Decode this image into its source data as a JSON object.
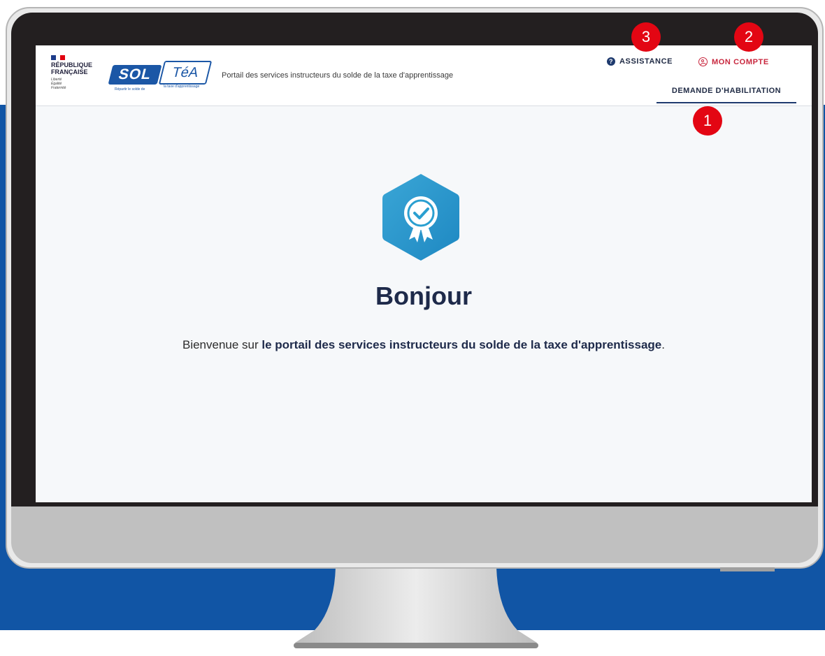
{
  "brand": {
    "republique_text": "RÉPUBLIQUE\nFRANÇAISE",
    "motto_text": "Liberté\nÉgalité\nFraternité",
    "logo_sol": "SOL",
    "logo_tea": "TéA",
    "logo_small_left": "Répartir le solde de",
    "logo_small_right": "la taxe d'apprentissage"
  },
  "header": {
    "portal_title": "Portail des services instructeurs du solde de la taxe d'apprentissage",
    "assistance_label": "ASSISTANCE",
    "account_label": "MON COMPTE",
    "habilitation_tab_label": "DEMANDE D'HABILITATION"
  },
  "main": {
    "greeting": "Bonjour",
    "welcome_prefix": "Bienvenue sur ",
    "welcome_bold": "le portail des services instructeurs du solde de la taxe d'apprentissage",
    "welcome_suffix": "."
  },
  "markers": {
    "one": "1",
    "two": "2",
    "three": "3"
  },
  "colors": {
    "background_band": "#1155a5",
    "accent_red": "#c8263d",
    "marker_red": "#e30613",
    "navy": "#1e3a6e",
    "badge_blue": "#2a9fd0"
  }
}
